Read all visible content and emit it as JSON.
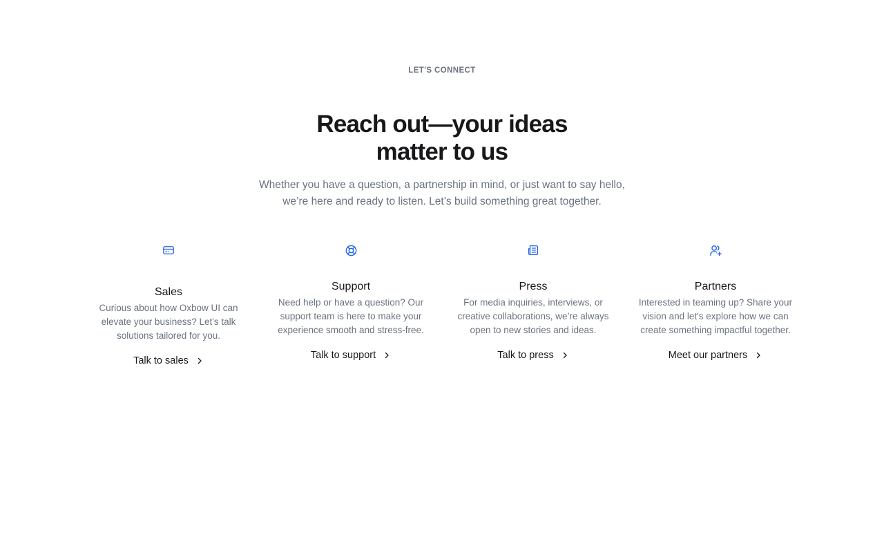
{
  "eyebrow": "LET'S CONNECT",
  "headline": "Reach out—your ideas matter to us",
  "subhead": "Whether you have a question, a partnership in mind, or just want to say hello, we’re here and ready to listen. Let’s build something great together.",
  "accent_color": "#2563eb",
  "cards": [
    {
      "icon": "credit-card-icon",
      "title": "Sales",
      "description": "Curious about how Oxbow UI can elevate your business? Let's talk solutions tailored for you.",
      "link": "Talk to sales"
    },
    {
      "icon": "lifebuoy-icon",
      "title": "Support",
      "description": "Need help or have a question? Our support team is here to make your experience smooth and stress-free.",
      "link": "Talk to support"
    },
    {
      "icon": "newspaper-icon",
      "title": "Press",
      "description": "For media inquiries, interviews, or creative collaborations, we’re always open to new stories and ideas.",
      "link": "Talk to press"
    },
    {
      "icon": "user-plus-icon",
      "title": "Partners",
      "description": "Interested in teaming up? Share your vision and let's explore how we can create something impactful together.",
      "link": "Meet our partners"
    }
  ]
}
